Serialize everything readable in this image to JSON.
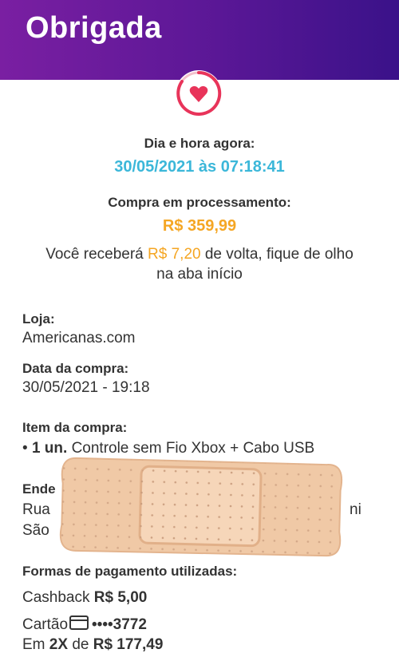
{
  "header": {
    "title": "Obrigada"
  },
  "status": {
    "datetime_label": "Dia e hora agora:",
    "datetime_value": "30/05/2021 às 07:18:41",
    "processing_label": "Compra em processamento:",
    "amount": "R$ 359,99",
    "cashback_prefix": "Você receberá",
    "cashback_amount": "R$ 7,20",
    "cashback_suffix": "de volta, fique de olho",
    "cashback_line2": "na aba início"
  },
  "store": {
    "label": "Loja:",
    "value": "Americanas.com"
  },
  "purchase_date": {
    "label": "Data da compra:",
    "value": "30/05/2021 - 19:18"
  },
  "item": {
    "label": "Item da compra:",
    "qty": "1 un.",
    "name": "Controle sem Fio Xbox + Cabo USB"
  },
  "address": {
    "label_visible": "Ende",
    "line1_visible": "Rua",
    "line1_tail": "ni",
    "line2_visible": "São"
  },
  "payment": {
    "label": "Formas de pagamento utilizadas:",
    "cashback_label": "Cashback",
    "cashback_value": "R$ 5,00",
    "card_label": "Cartão",
    "card_number": "••••3772",
    "installments_prefix": "Em",
    "installments_count": "2X",
    "installments_mid": "de",
    "installments_value": "R$ 177,49"
  },
  "colors": {
    "header_start": "#7a1fa2",
    "header_end": "#3a1289",
    "datetime": "#3bb7d9",
    "amount": "#f5a623",
    "heart": "#e8345a",
    "bandage": "#f0c9a6"
  },
  "icons": {
    "heart": "heart-icon",
    "card": "credit-card-icon"
  }
}
